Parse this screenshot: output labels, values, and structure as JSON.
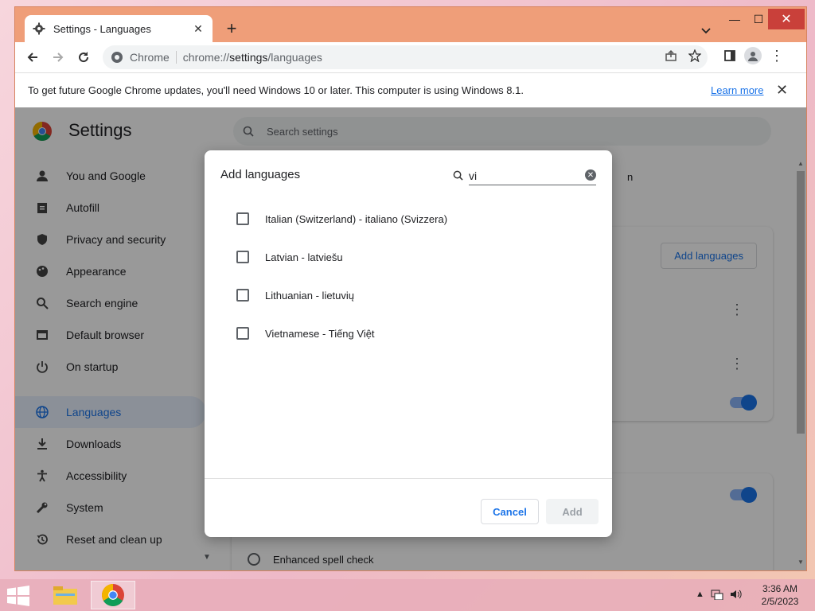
{
  "tab": {
    "title": "Settings - Languages"
  },
  "toolbar": {
    "site_label": "Chrome",
    "url_scheme": "chrome://",
    "url_host": "settings",
    "url_path": "/languages"
  },
  "infobar": {
    "message": "To get future Google Chrome updates, you'll need Windows 10 or later. This computer is using Windows 8.1.",
    "link": "Learn more"
  },
  "settings": {
    "title": "Settings",
    "search_placeholder": "Search settings",
    "sidebar": [
      {
        "label": "You and Google",
        "icon": "person-icon"
      },
      {
        "label": "Autofill",
        "icon": "clipboard-icon"
      },
      {
        "label": "Privacy and security",
        "icon": "shield-icon"
      },
      {
        "label": "Appearance",
        "icon": "palette-icon"
      },
      {
        "label": "Search engine",
        "icon": "search-icon"
      },
      {
        "label": "Default browser",
        "icon": "browser-icon"
      },
      {
        "label": "On startup",
        "icon": "power-icon"
      },
      {
        "label": "Languages",
        "icon": "globe-icon"
      },
      {
        "label": "Downloads",
        "icon": "download-icon"
      },
      {
        "label": "Accessibility",
        "icon": "accessibility-icon"
      },
      {
        "label": "System",
        "icon": "wrench-icon"
      },
      {
        "label": "Reset and clean up",
        "icon": "history-icon"
      }
    ],
    "add_languages_button": "Add languages",
    "spell_check_option": "Enhanced spell check",
    "partial_text": "n"
  },
  "dialog": {
    "title": "Add languages",
    "search_value": "vi",
    "languages": [
      "Italian (Switzerland) - italiano (Svizzera)",
      "Latvian - latviešu",
      "Lithuanian - lietuvių",
      "Vietnamese - Tiếng Việt"
    ],
    "cancel_label": "Cancel",
    "add_label": "Add"
  },
  "taskbar": {
    "time": "3:36 AM",
    "date": "2/5/2023"
  }
}
